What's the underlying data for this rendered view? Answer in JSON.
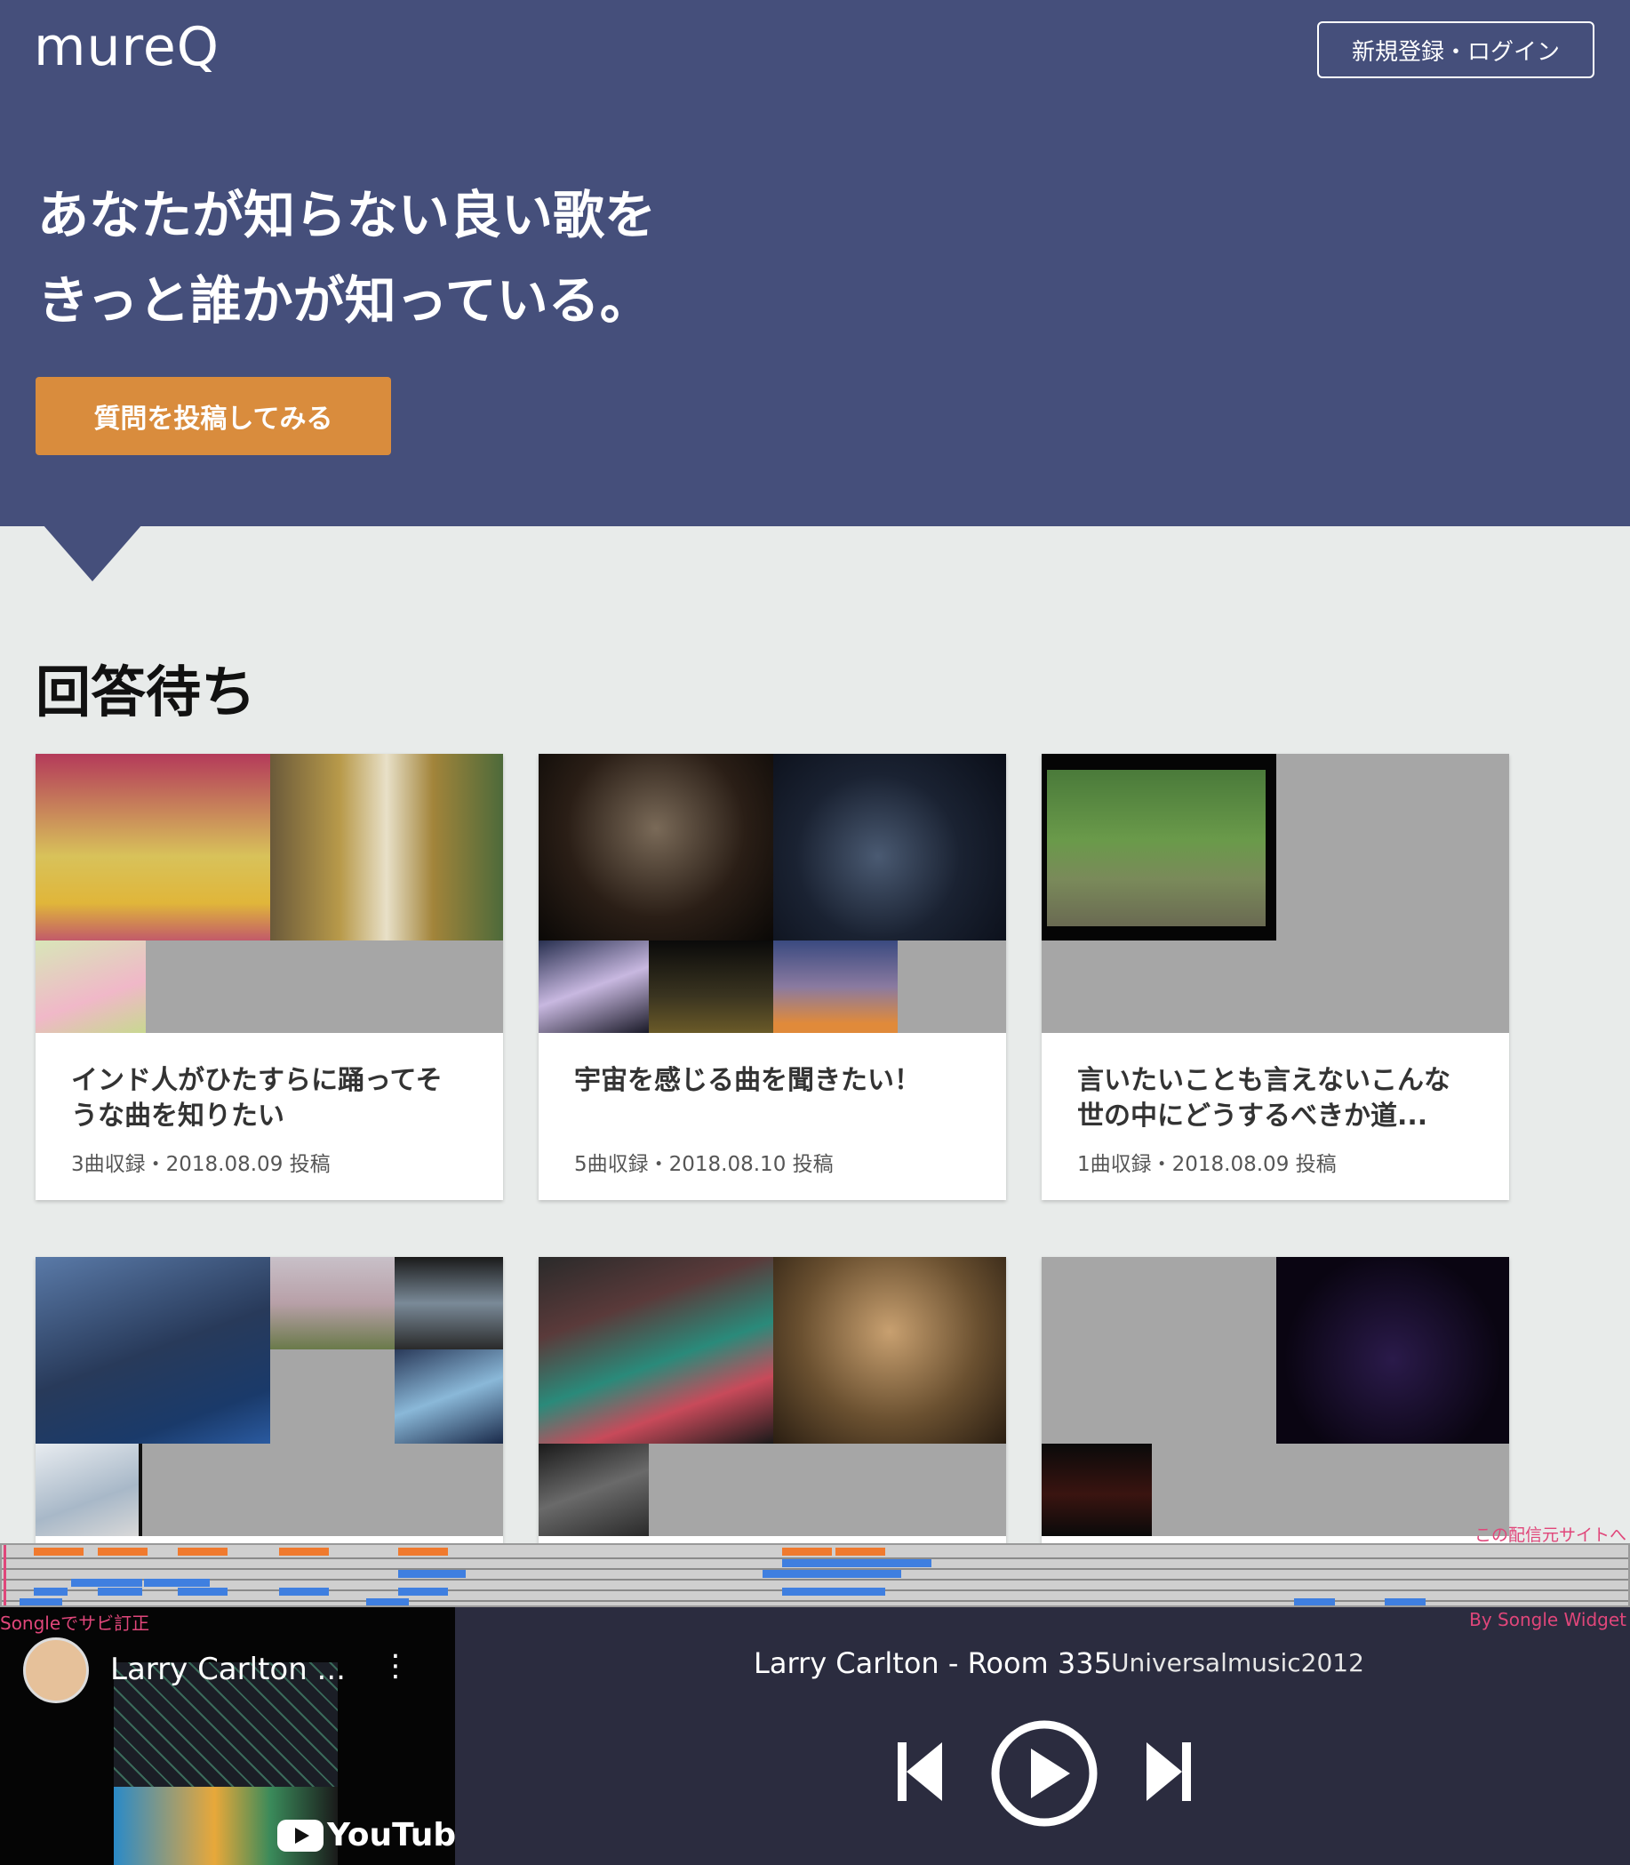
{
  "header": {
    "logo": "mureQ",
    "login_label": "新規登録・ログイン"
  },
  "hero": {
    "line1": "あなたが知らない良い歌を",
    "line2": "きっと誰かが知っている。",
    "cta_label": "質問を投稿してみる"
  },
  "section": {
    "title": "回答待ち"
  },
  "cards": [
    {
      "question": "インド人がひたすらに踊ってそうな曲を知りたい",
      "meta": "3曲収録・2018.08.09 投稿"
    },
    {
      "question": "宇宙を感じる曲を聞きたい！",
      "meta": "5曲収録・2018.08.10 投稿"
    },
    {
      "question": "言いたいことも言えないこんな世の中にどうするべきか道...",
      "meta": "1曲収録・2018.08.09 投稿"
    },
    {
      "question": "",
      "meta": ""
    },
    {
      "question": "",
      "meta": ""
    },
    {
      "question": "",
      "meta": ""
    }
  ],
  "songle": {
    "site_link": "この配信元サイトへ",
    "fix_label": "Songleでサビ訂正",
    "by_label": "By Songle Widget"
  },
  "player": {
    "yt_title": "Larry Carlton ...",
    "yt_brand": "YouTube",
    "track_title": "Larry Carlton - Room 335",
    "channel": "Universalmusic2012"
  },
  "colors": {
    "hero_bg": "#454f7b",
    "accent_orange": "#d98c3d",
    "player_bg": "#2b2c3f",
    "songle_pink": "#e0467a"
  },
  "icons": {
    "prev": "skip-previous-icon",
    "play": "play-circle-icon",
    "next": "skip-next-icon",
    "menu": "kebab-menu-icon"
  }
}
